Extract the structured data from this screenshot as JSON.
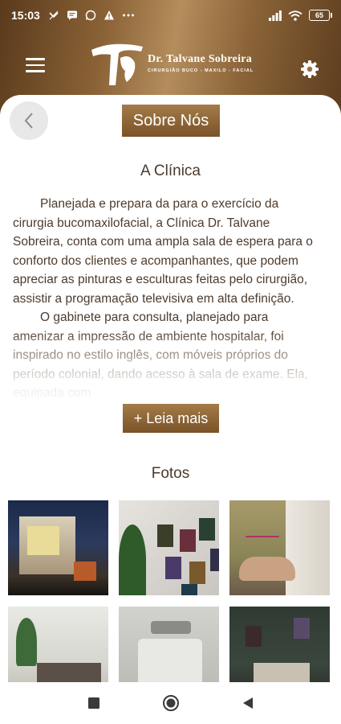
{
  "status_bar": {
    "time": "15:03",
    "battery": "65"
  },
  "header": {
    "logo_name": "Dr. Talvane Sobreira",
    "logo_subtitle": "CIRURGIÃO BUCO - MAXILO - FACIAL"
  },
  "page": {
    "title": "Sobre Nós",
    "section_clinic": "A Clínica",
    "paragraph_1": "Planejada e prepara da para o exercício da cirurgia bucomaxilofacial, a Clínica Dr.   Talvane Sobreira, conta com uma ampla sala de espera para o conforto dos clientes e    acompanhantes, que podem apreciar as pinturas e esculturas feitas pelo cirurgião,     assistir a programação televisiva em alta definição.",
    "paragraph_2": "O gabinete para consulta, planejado para amenizar a impressão de ambiente hospitalar,  foi inspirado no estilo inglês, com móveis próprios do período colonial, dando acesso  à sala de exame. Ela, equipada com",
    "read_more": "+ Leia mais",
    "section_photos": "Fotos"
  },
  "icons": {
    "menu": "hamburger-menu-icon",
    "settings": "gear-icon",
    "back": "chevron-left-icon",
    "nav_recent": "square-icon",
    "nav_home": "circle-icon",
    "nav_back": "triangle-left-icon"
  },
  "colors": {
    "brand_gold": "#9a7040",
    "brand_dark": "#5a3a1c",
    "text_brown": "#4e3b2c"
  }
}
